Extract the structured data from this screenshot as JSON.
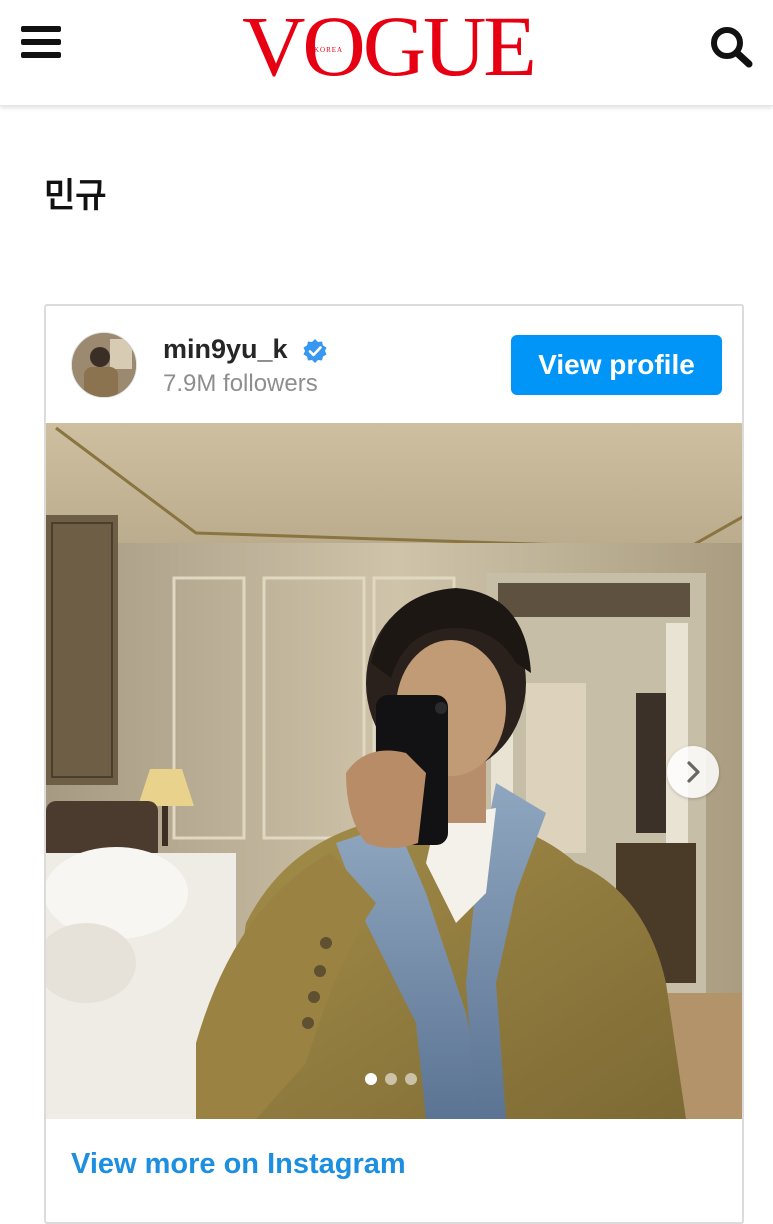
{
  "header": {
    "logo_text": "VOGUE",
    "logo_sub": "KOREA",
    "brand_color": "#e60012",
    "menu_icon": "hamburger-menu-icon",
    "search_icon": "search-icon"
  },
  "page": {
    "title": "민규"
  },
  "instagram_embed": {
    "username": "min9yu_k",
    "verified": true,
    "followers": "7.9M followers",
    "view_profile_label": "View profile",
    "view_more_label": "View more on Instagram",
    "accent_color": "#0095f6",
    "carousel": {
      "current_index": 1,
      "total": 3
    }
  }
}
